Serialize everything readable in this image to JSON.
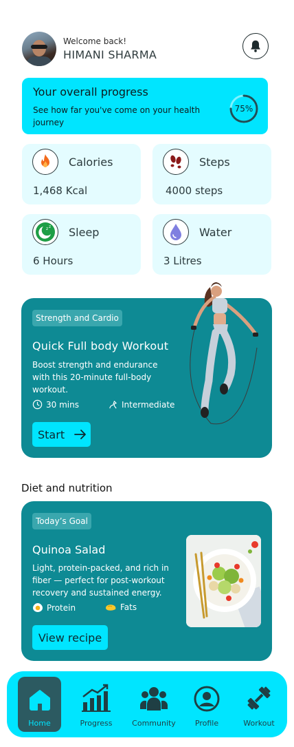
{
  "header": {
    "welcome": "Welcome back!",
    "username": "HIMANI SHARMA",
    "avatar_icon": "user-photo",
    "notification_icon": "bell-icon"
  },
  "progress": {
    "title": "Your overall progress",
    "description": "See how far you've come on  your health journey",
    "percent_label": "75%",
    "percent_value": 75
  },
  "stats": [
    {
      "title": "Calories",
      "value": "1,468  Kcal",
      "icon": "fire-icon"
    },
    {
      "title": "Steps",
      "value": "4000 steps",
      "icon": "footsteps-icon"
    },
    {
      "title": "Sleep",
      "value": "6 Hours",
      "icon": "moon-sleep-icon"
    },
    {
      "title": "Water",
      "value": "3 Litres",
      "icon": "water-drop-icon"
    }
  ],
  "workout": {
    "tag": "Strength and Cardio",
    "title": "Quick Full body Workout",
    "description": "Boost strength and endurance with this 20-minute full-body workout.",
    "duration": "30 mins",
    "level": "Intermediate",
    "cta": "Start"
  },
  "diet": {
    "section_title": "Diet and nutrition",
    "tag": "Today’s Goal",
    "title": "Quinoa Salad",
    "description": "Light, protein-packed, and rich in fiber — perfect for post-workout recovery and sustained energy.",
    "protein": "Protein",
    "fats": "Fats",
    "cta": "View recipe"
  },
  "nav": {
    "items": [
      {
        "label": "Home",
        "icon": "home-icon",
        "active": true
      },
      {
        "label": "Progress",
        "icon": "bar-chart-icon",
        "active": false
      },
      {
        "label": "Community",
        "icon": "people-icon",
        "active": false
      },
      {
        "label": "Profile",
        "icon": "profile-icon",
        "active": false
      },
      {
        "label": "Workout",
        "icon": "dumbbell-icon",
        "active": false
      }
    ]
  },
  "colors": {
    "accent": "#00e5ff",
    "card_teal": "#0e8a94",
    "stat_bg": "#e4fcff",
    "nav_active": "#2c5a61"
  }
}
